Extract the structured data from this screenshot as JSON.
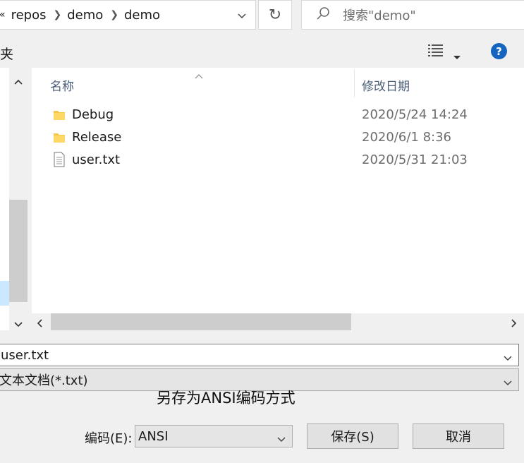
{
  "address_bar": {
    "overflow": "«",
    "segments": [
      "repos",
      "demo",
      "demo"
    ]
  },
  "search": {
    "placeholder": "搜索\"demo\""
  },
  "toolbar": {
    "new_folder_fragment": "夹",
    "help": "?"
  },
  "file_list": {
    "columns": {
      "name": "名称",
      "date": "修改日期"
    },
    "rows": [
      {
        "name": "Debug",
        "date": "2020/5/24 14:24",
        "type": "folder"
      },
      {
        "name": "Release",
        "date": "2020/6/1 8:36",
        "type": "folder"
      },
      {
        "name": "user.txt",
        "date": "2020/5/31 21:03",
        "type": "text-file"
      }
    ]
  },
  "filename": {
    "value": "user.txt"
  },
  "filetype": {
    "value": "文本文档(*.txt)"
  },
  "annotation": "另存为ANSI编码方式",
  "encoding": {
    "label": "编码(E):",
    "value": "ANSI"
  },
  "buttons": {
    "save": "保存(S)",
    "cancel": "取消"
  },
  "colors": {
    "accent": "#1565c0",
    "folder": "#f5c54c"
  }
}
